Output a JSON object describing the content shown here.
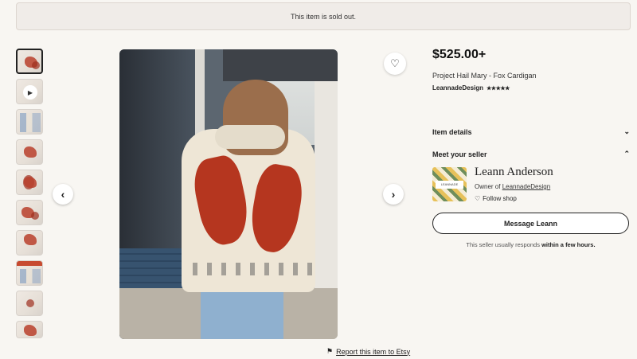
{
  "banner": {
    "text": "This item is sold out."
  },
  "gallery": {
    "thumbnail_count": 10,
    "active_index": 0,
    "video_thumb_index": 1,
    "prev_icon": "chevron-left-icon",
    "next_icon": "chevron-right-icon"
  },
  "listing": {
    "price": "$525.00+",
    "title": "Project Hail Mary - Fox Cardigan",
    "shop_name": "LeannadeDesign",
    "rating_stars": "★★★★★",
    "rating": 5
  },
  "sections": {
    "item_details": "Item details",
    "meet_seller": "Meet your seller"
  },
  "seller": {
    "name": "Leann Anderson",
    "owner_prefix": "Owner of ",
    "shop_link": "LeannadeDesign",
    "follow_label": "Follow shop",
    "logo_text": "LEANNADE"
  },
  "actions": {
    "message_button": "Message Leann",
    "report_link": "Report this item to Etsy"
  },
  "response": {
    "prefix": "This seller usually responds ",
    "emphasis": "within a few hours."
  },
  "icons": {
    "favorite": "heart-icon",
    "flag": "flag-icon",
    "chevron_down": "chevron-down-icon",
    "chevron_up": "chevron-up-icon",
    "play": "play-icon"
  },
  "colors": {
    "background": "#f8f6f2",
    "banner": "#f0ece8",
    "accent": "#222222"
  }
}
